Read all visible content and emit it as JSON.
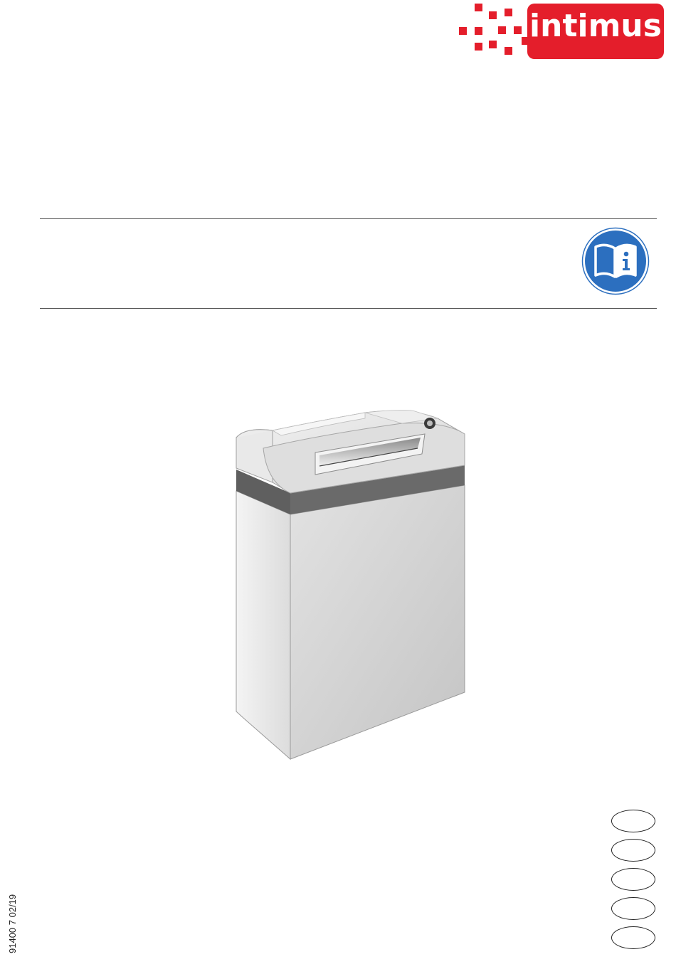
{
  "brand": {
    "name": "intimus",
    "color": "#e41e2b",
    "icon": "pixel-dots-logo-icon"
  },
  "safety_sign": {
    "icon": "read-manual-info-icon",
    "color": "#2c6fbf"
  },
  "product": {
    "icon": "paper-shredder-illustration"
  },
  "language_markers": {
    "count": 5
  },
  "footer": {
    "doc_number": "91400 7 02/19"
  }
}
